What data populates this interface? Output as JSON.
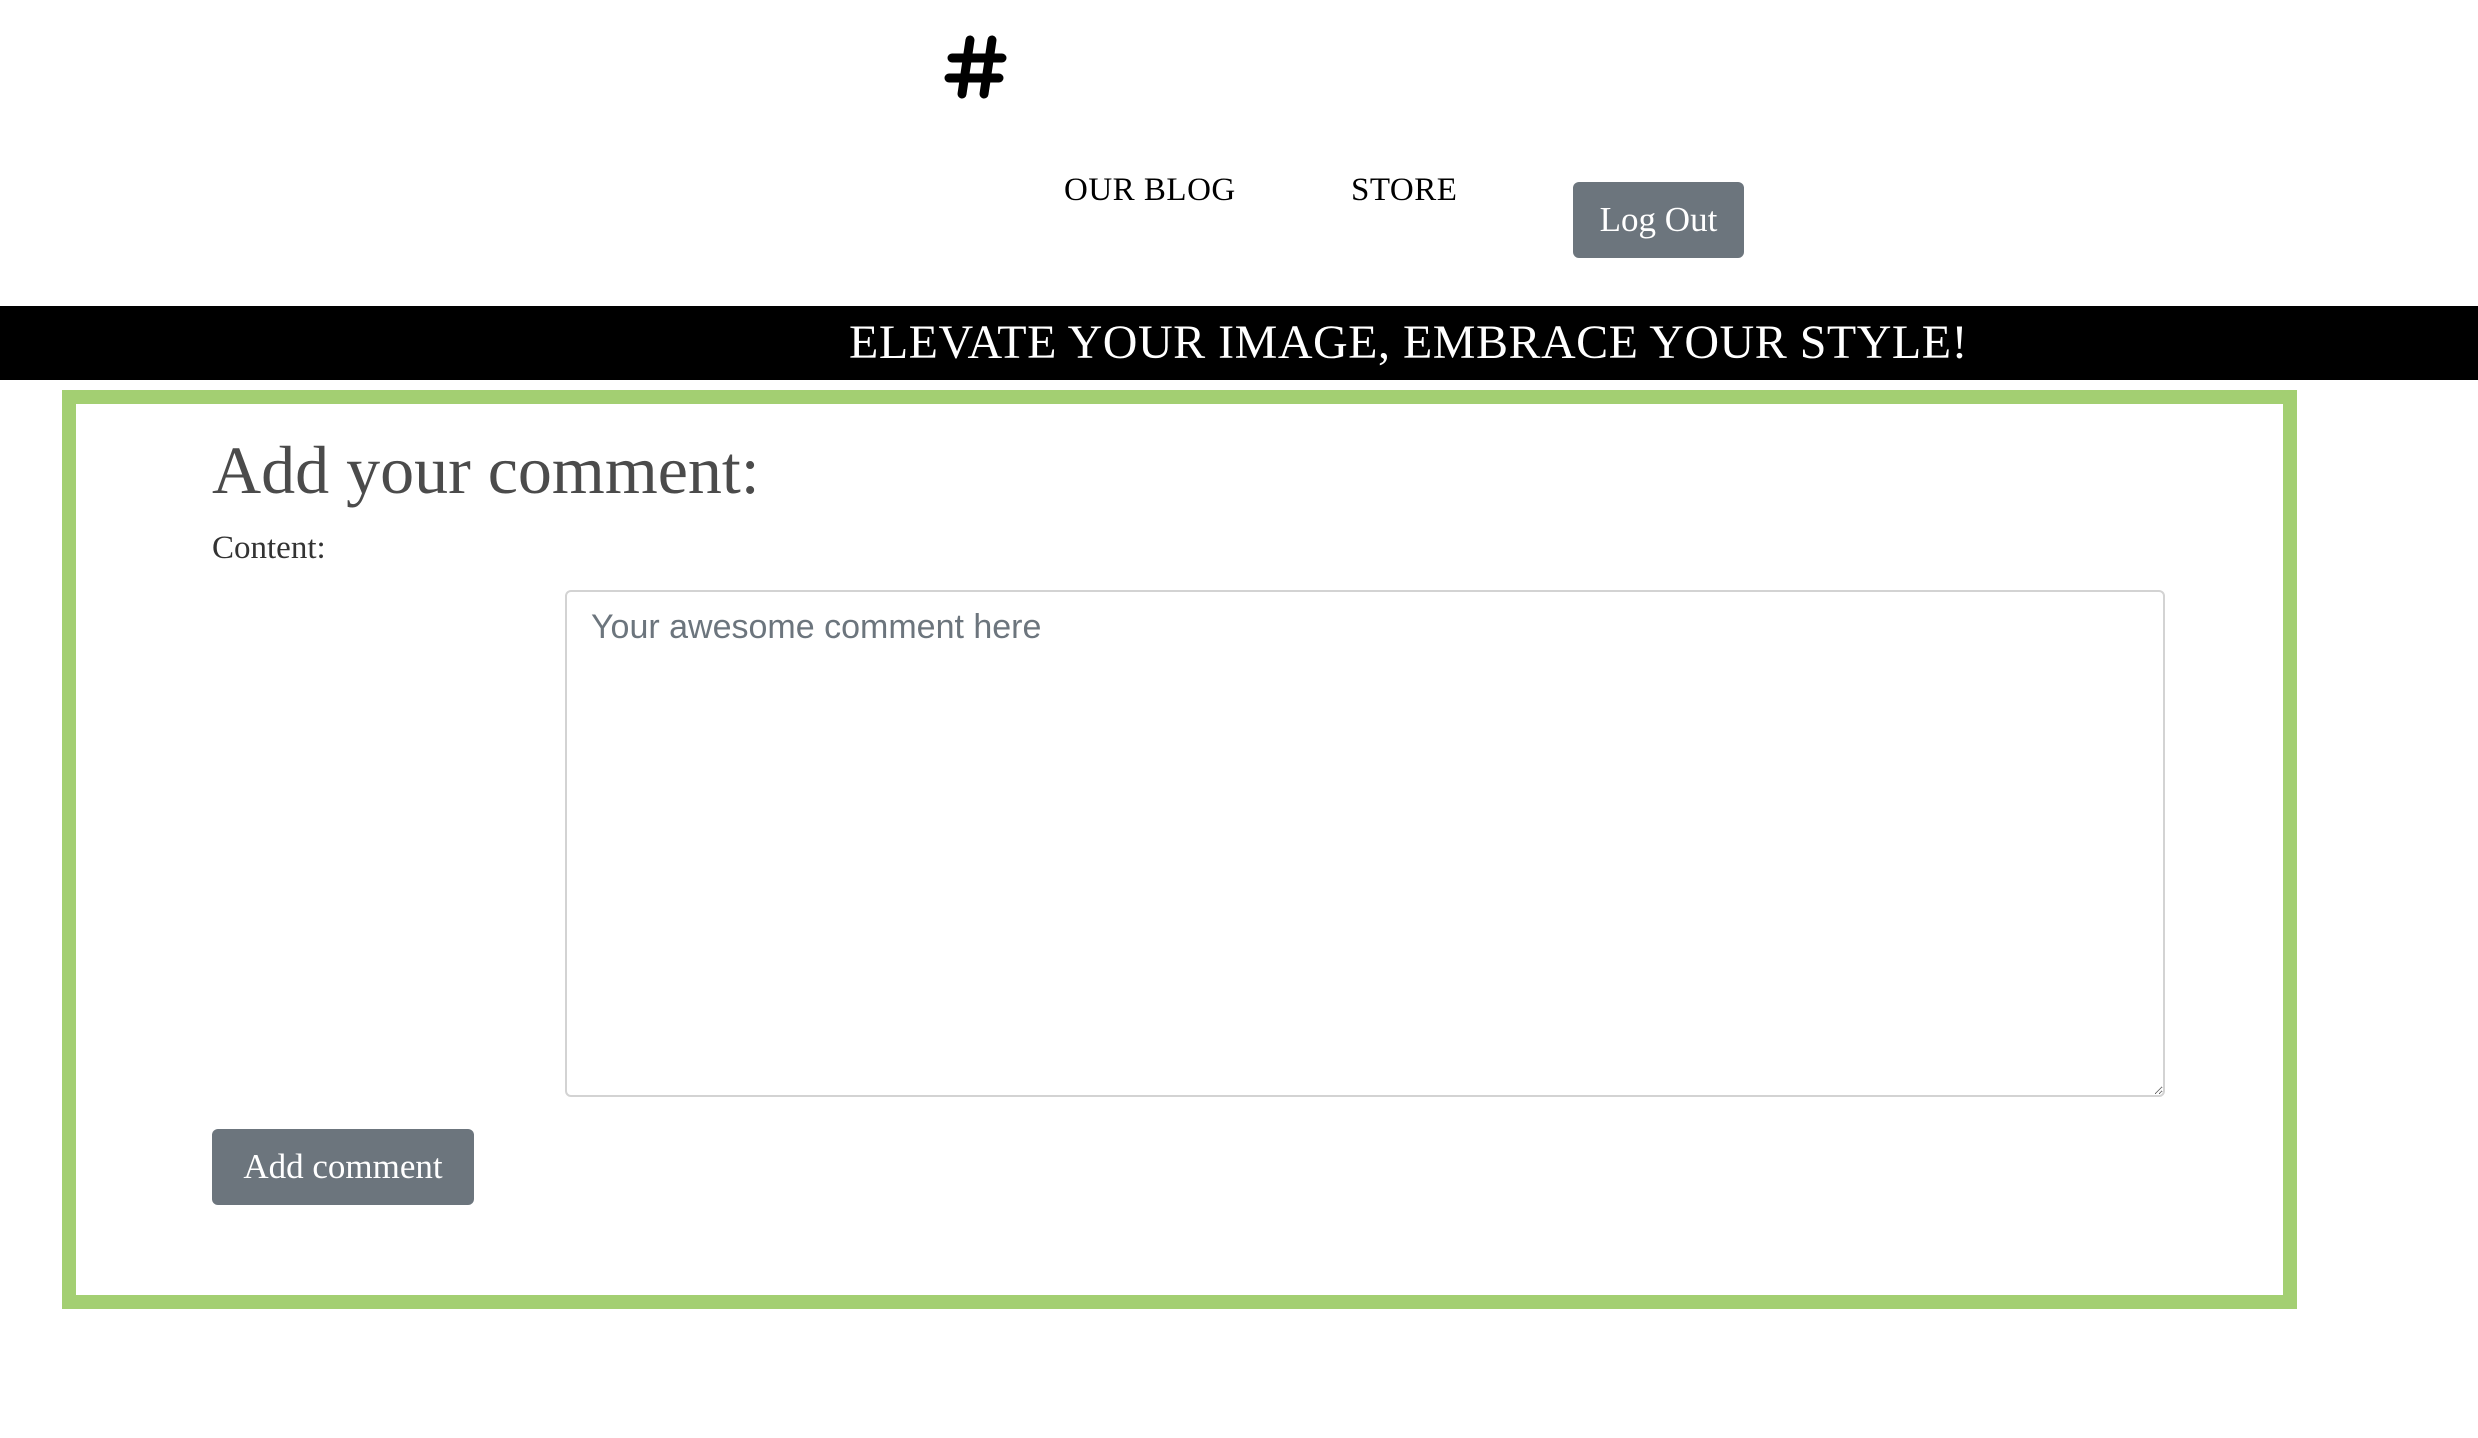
{
  "header": {
    "logo_icon": "hash-icon",
    "nav": {
      "blog_label": "OUR BLOG",
      "store_label": "STORE"
    },
    "logout_label": "Log Out"
  },
  "banner": {
    "text": "ELEVATE YOUR IMAGE, EMBRACE YOUR STYLE!"
  },
  "comment_form": {
    "title": "Add your comment:",
    "content_label": "Content:",
    "content_value": "",
    "content_placeholder": "Your awesome comment here",
    "submit_label": "Add comment"
  },
  "colors": {
    "panel_border": "#a3cf72",
    "button_bg": "#6c757d",
    "banner_bg": "#000000"
  }
}
